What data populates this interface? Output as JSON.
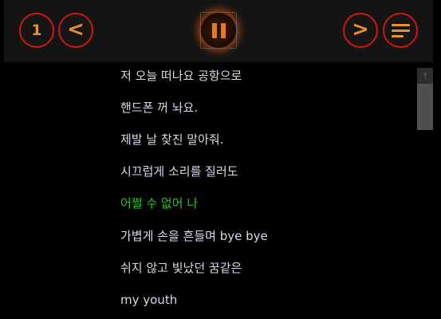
{
  "toolbar": {
    "left_buttons": [
      {
        "name": "number-one-icon",
        "glyph": "1"
      },
      {
        "name": "chevron-left-icon",
        "glyph": "<"
      }
    ],
    "right_buttons": [
      {
        "name": "chevron-right-icon",
        "glyph": ">"
      },
      {
        "name": "menu-icon"
      }
    ],
    "play_state": "paused"
  },
  "lyrics": {
    "lines": [
      "저 오늘 떠나요 공항으로",
      "핸드폰 꺼 놔요.",
      "제발 날 찾진 말아줘.",
      "시끄럽게 소리를 질러도",
      "어쩔 수 없어 나",
      "가볍게 손을 흔들며 bye bye",
      "쉬지 않고 빛났던 꿈같은",
      "my youth"
    ],
    "active_index": 4
  },
  "colors": {
    "accent": "#e8902a",
    "button_ring": "#d11515",
    "active_line": "#26c526",
    "lyric_text": "#d7dae8",
    "toolbar_bg": "#141414"
  },
  "scrollbar": {
    "up_arrow": "↑"
  }
}
